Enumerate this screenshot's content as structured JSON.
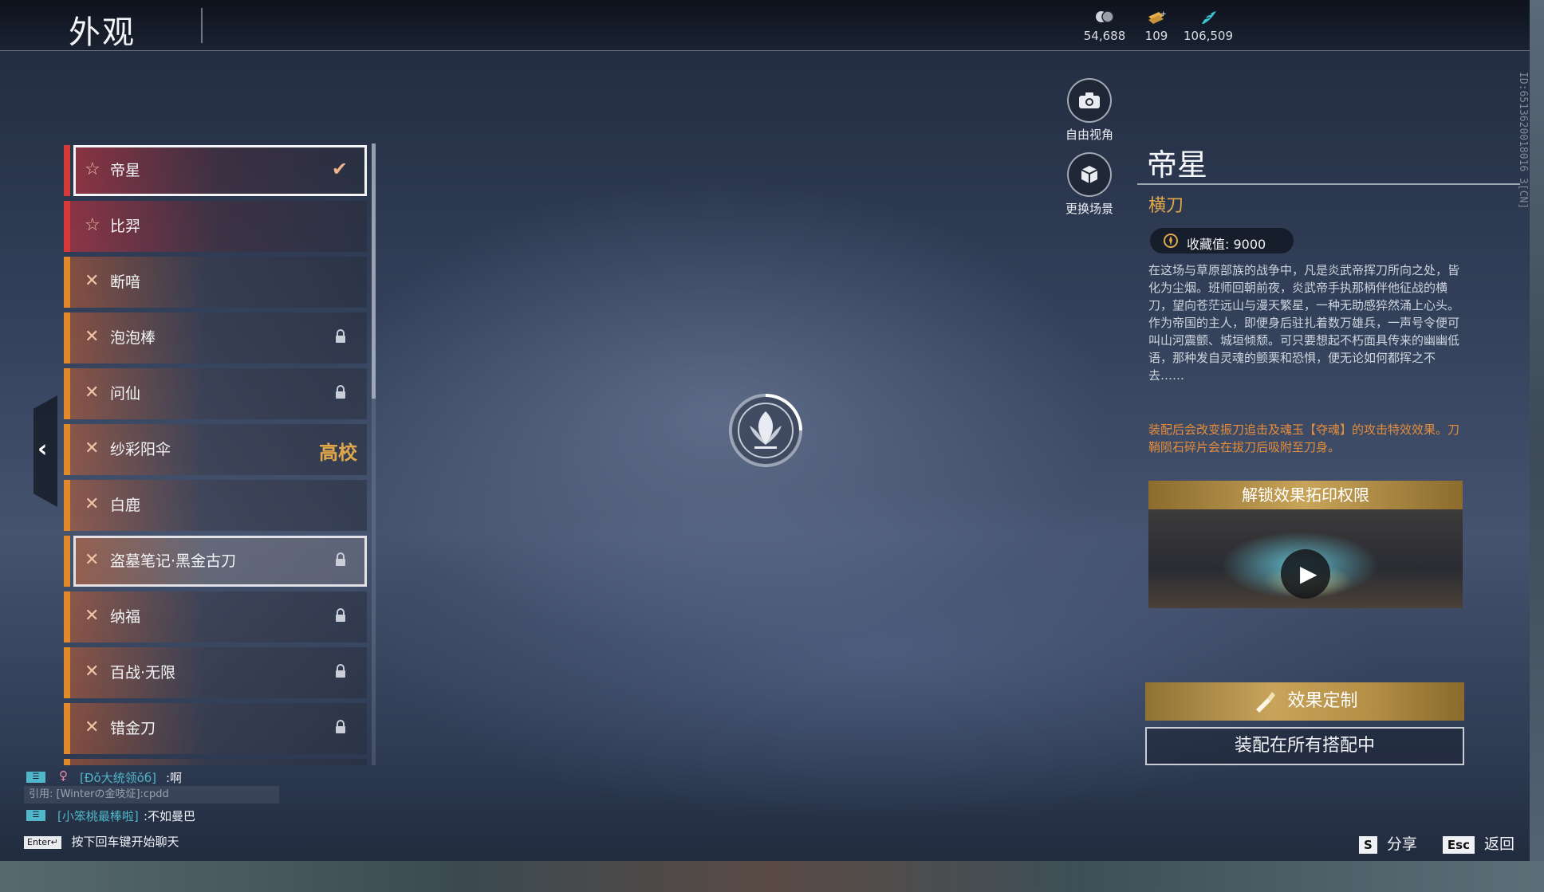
{
  "header": {
    "title": "外观",
    "currencies": [
      {
        "icon": "coin-stack-icon",
        "value": "54,688"
      },
      {
        "icon": "ticket-plus-icon",
        "value": "109"
      },
      {
        "icon": "feather-icon",
        "value": "106,509"
      }
    ]
  },
  "view_controls": {
    "free_view": "自由视角",
    "change_scene": "更换场景"
  },
  "version_id": "ID:6513620018016 3[CN]",
  "skin_list": [
    {
      "name": "帝星",
      "rarity": "red",
      "status": "equipped"
    },
    {
      "name": "比羿",
      "rarity": "red",
      "status": ""
    },
    {
      "name": "断喑",
      "rarity": "orange",
      "status": ""
    },
    {
      "name": "泡泡棒",
      "rarity": "orange",
      "status": "locked"
    },
    {
      "name": "问仙",
      "rarity": "orange",
      "status": "locked"
    },
    {
      "name": "纱彩阳伞",
      "rarity": "orange",
      "status": "badge",
      "badge": "高校"
    },
    {
      "name": "白鹿",
      "rarity": "orange",
      "status": ""
    },
    {
      "name": "盗墓笔记·黑金古刀",
      "rarity": "orange",
      "status": "locked"
    },
    {
      "name": "纳福",
      "rarity": "orange",
      "status": "locked"
    },
    {
      "name": "百战·无限",
      "rarity": "orange",
      "status": "locked"
    },
    {
      "name": "错金刀",
      "rarity": "orange",
      "status": "locked"
    }
  ],
  "detail": {
    "title": "帝星",
    "weapon_type": "横刀",
    "collection_label": "收藏值: 9000",
    "description": "在这场与草原部族的战争中，凡是炎武帝挥刀所向之处，皆化为尘烟。班师回朝前夜，炎武帝手执那柄伴他征战的横刀，望向苍茫远山与漫天繁星，一种无助感猝然涌上心头。作为帝国的主人，即便身后驻扎着数万雄兵，一声号令便可叫山河震颤、城垣倾颓。可只要想起不朽面具传来的幽幽低语，那种发自灵魂的颤栗和恐惧，便无论如何都挥之不去……",
    "effect_text": "装配后会改变振刀追击及魂玉【夺魂】的攻击特效效果。刀鞘陨石碎片会在拔刀后吸附至刀身。",
    "video_title": "解锁效果拓印权限",
    "customize_label": "效果定制",
    "equip_all_label": "装配在所有搭配中"
  },
  "chat": {
    "messages": [
      {
        "channel": "group-icon",
        "gender": "female-icon",
        "user": "[Ðǒ大统领ǒб]",
        "text": ":啊"
      },
      {
        "quote": "引用: [Winterの金吱炡]:cpdd"
      },
      {
        "channel": "group-icon",
        "user": "[小笨桃最棒啦]",
        "text": ":不如曼巴"
      }
    ],
    "hint_key": "Enter↵",
    "hint_text": "按下回车键开始聊天"
  },
  "footer": {
    "share_key": "S",
    "share_label": "分享",
    "back_key": "Esc",
    "back_label": "返回"
  },
  "colors": {
    "accent_gold": "#e0a84a",
    "effect_orange": "#e38d3c",
    "rarity_red": "#d43a3a",
    "rarity_orange": "#e08a2c"
  }
}
